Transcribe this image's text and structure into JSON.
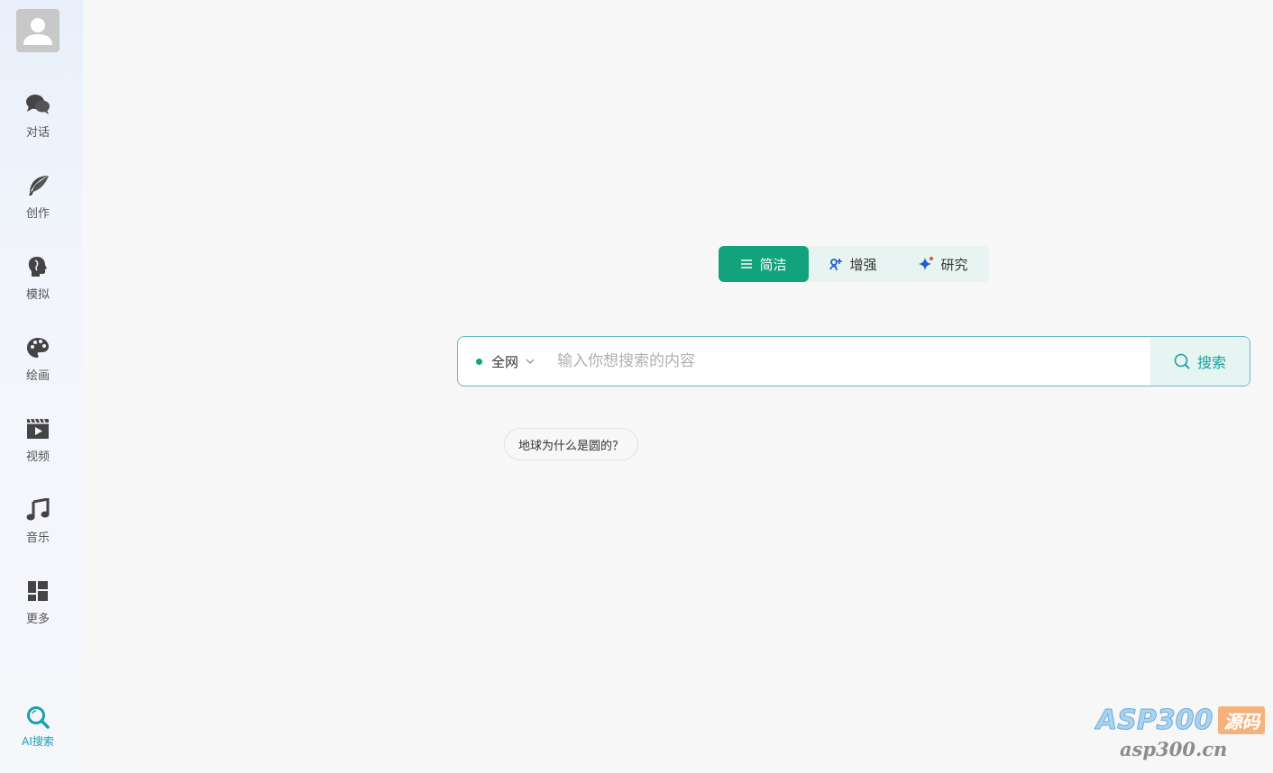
{
  "sidebar": {
    "items": [
      {
        "label": "对话",
        "icon": "chat-bubbles-icon"
      },
      {
        "label": "创作",
        "icon": "feather-icon"
      },
      {
        "label": "模拟",
        "icon": "head-profile-icon"
      },
      {
        "label": "绘画",
        "icon": "palette-icon"
      },
      {
        "label": "视频",
        "icon": "video-clapper-icon"
      },
      {
        "label": "音乐",
        "icon": "music-note-icon"
      },
      {
        "label": "更多",
        "icon": "grid-icon"
      }
    ],
    "bottom_item": {
      "label": "AI搜索",
      "icon": "search-icon"
    }
  },
  "modes": {
    "active": "简洁",
    "tabs": [
      {
        "label": "简洁",
        "icon": "list-icon"
      },
      {
        "label": "增强",
        "icon": "enhance-icon"
      },
      {
        "label": "研究",
        "icon": "sparkle-icon"
      }
    ]
  },
  "search": {
    "scope_label": "全网",
    "placeholder": "输入你想搜索的内容",
    "value": "",
    "button_label": "搜索"
  },
  "suggestions": [
    "地球为什么是圆的？"
  ],
  "watermark": {
    "brand": "ASP300",
    "badge": "源码",
    "domain": "asp300.cn"
  },
  "colors": {
    "accent": "#13a37c",
    "search_accent": "#1a9fa0",
    "active_nav": "#1a9fb0"
  }
}
